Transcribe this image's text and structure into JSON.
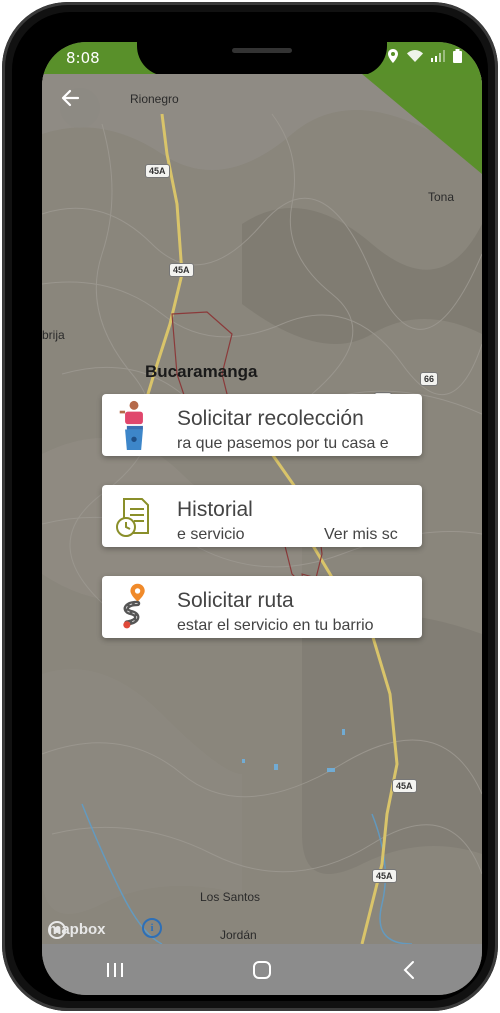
{
  "status_bar": {
    "time": "8:08",
    "icons": [
      "location-icon",
      "wifi-icon",
      "signal-icon",
      "battery-icon"
    ]
  },
  "map": {
    "labels": {
      "rionegro": "Rionegro",
      "tona": "Tona",
      "girija": "brija",
      "bucaramanga": "Bucaramanga",
      "los_santos": "Los Santos",
      "jordan": "Jordán"
    },
    "shields": {
      "r45a_1": "45A",
      "r45a_2": "45A",
      "r66_1": "66",
      "r66_2": "66",
      "r45a_3": "45A",
      "r45a_4": "45A"
    },
    "attribution": "mapbox",
    "info_symbol": "i"
  },
  "cards": [
    {
      "title": "Solicitar recolección",
      "subtitle": "ra que pasemos por tu casa e",
      "icon": "person-trash-bin-icon"
    },
    {
      "title": "Historial",
      "subtitle_left": "e servicio",
      "subtitle_right": "Ver mis sc",
      "icon": "document-clock-icon"
    },
    {
      "title": "Solicitar ruta",
      "subtitle": "estar el servicio en tu barrio",
      "icon": "route-pin-icon"
    }
  ],
  "colors": {
    "accent_green": "#59902a",
    "map_bg": "#888479",
    "road_yellow": "#d9c46a",
    "boundary_red": "#8b3a3a"
  },
  "nav": {
    "items": [
      "recents-icon",
      "home-icon",
      "back-icon"
    ]
  }
}
